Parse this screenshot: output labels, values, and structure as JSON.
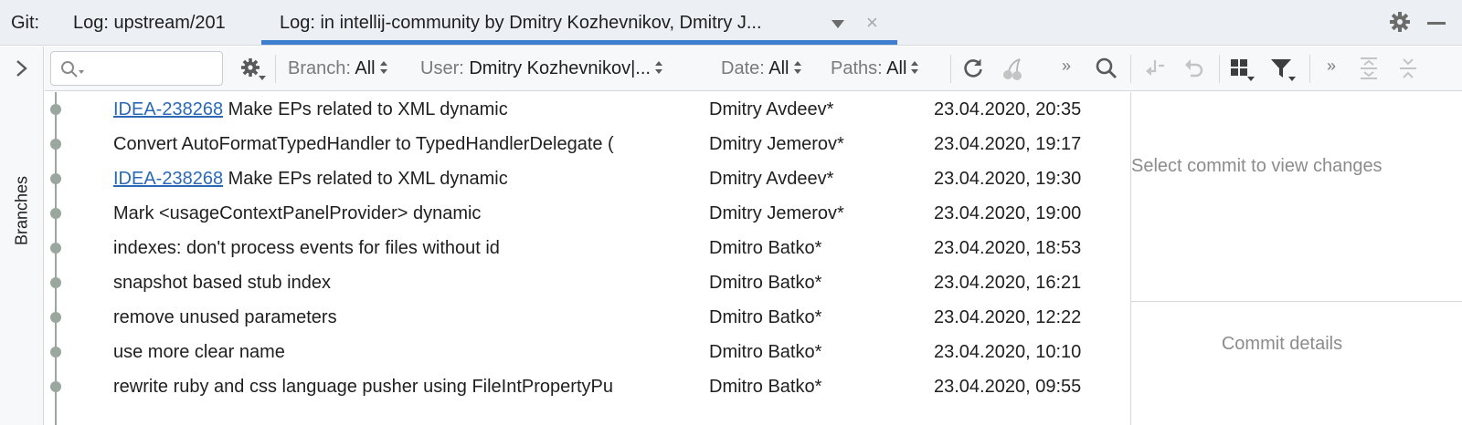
{
  "tabbar": {
    "git_label": "Git:",
    "tabs": [
      {
        "label": "Log: upstream/201"
      },
      {
        "label": "Log: in intellij-community by Dmitry Kozhevnikov, Dmitry J..."
      }
    ],
    "close_glyph": "×",
    "icons": [
      "gear-icon",
      "minimize-icon",
      "chevron-down-icon",
      "close-icon"
    ]
  },
  "sidebar": {
    "branches_label": "Branches",
    "icons": [
      "chevron-right-icon"
    ]
  },
  "toolbar": {
    "search": {
      "value": "",
      "placeholder": ""
    },
    "filters": {
      "branch": {
        "label": "Branch:",
        "value": "All"
      },
      "user": {
        "label": "User:",
        "value": "Dmitry Kozhevnikov|..."
      },
      "date": {
        "label": "Date:",
        "value": "All"
      },
      "paths": {
        "label": "Paths:",
        "value": "All"
      }
    },
    "more_glyph": "»",
    "icons": [
      "search-icon",
      "gear-icon",
      "refresh-icon",
      "cherry-pick-icon",
      "more-icon",
      "magnifier-icon",
      "pull-icon",
      "revert-icon",
      "grid-icon",
      "filter-icon",
      "expand-all-icon",
      "collapse-all-icon"
    ]
  },
  "commits": [
    {
      "issue": "IDEA-238268",
      "subject": " Make EPs related to XML dynamic",
      "author": "Dmitry Avdeev*",
      "date": "23.04.2020, 20:35"
    },
    {
      "issue": "",
      "subject": "Convert AutoFormatTypedHandler to TypedHandlerDelegate (",
      "author": "Dmitry Jemerov*",
      "date": "23.04.2020, 19:17"
    },
    {
      "issue": "IDEA-238268",
      "subject": " Make EPs related to XML dynamic",
      "author": "Dmitry Avdeev*",
      "date": "23.04.2020, 19:30"
    },
    {
      "issue": "",
      "subject": "Mark <usageContextPanelProvider> dynamic",
      "author": "Dmitry Jemerov*",
      "date": "23.04.2020, 19:00"
    },
    {
      "issue": "",
      "subject": "indexes: don't process events for files without id",
      "author": "Dmitro Batko*",
      "date": "23.04.2020, 18:53"
    },
    {
      "issue": "",
      "subject": "snapshot based stub index",
      "author": "Dmitro Batko*",
      "date": "23.04.2020, 16:21"
    },
    {
      "issue": "",
      "subject": "remove unused parameters",
      "author": "Dmitro Batko*",
      "date": "23.04.2020, 12:22"
    },
    {
      "issue": "",
      "subject": "use more clear name",
      "author": "Dmitro Batko*",
      "date": "23.04.2020, 10:10"
    },
    {
      "issue": "",
      "subject": "rewrite ruby and css language pusher using FileIntPropertyPu",
      "author": "Dmitro Batko*",
      "date": "23.04.2020, 09:55"
    }
  ],
  "details": {
    "changes_message": "Select commit to view changes",
    "details_message": "Commit details"
  },
  "colors": {
    "accent": "#3f7fcf",
    "link": "#2b69b7",
    "graph": "#9aa79e",
    "muted_text": "#8c8c8c"
  }
}
